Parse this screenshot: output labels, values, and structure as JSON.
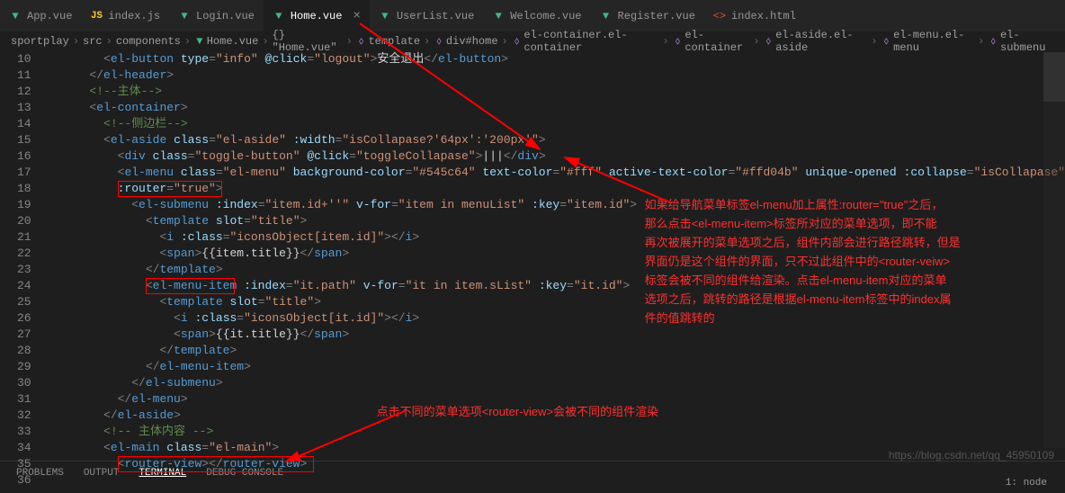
{
  "tabs": [
    {
      "icon": "vue",
      "label": "App.vue",
      "active": false
    },
    {
      "icon": "js",
      "label": "index.js",
      "active": false
    },
    {
      "icon": "vue",
      "label": "Login.vue",
      "active": false
    },
    {
      "icon": "vue",
      "label": "Home.vue",
      "active": true
    },
    {
      "icon": "vue",
      "label": "UserList.vue",
      "active": false
    },
    {
      "icon": "vue",
      "label": "Welcome.vue",
      "active": false
    },
    {
      "icon": "vue",
      "label": "Register.vue",
      "active": false
    },
    {
      "icon": "html",
      "label": "index.html",
      "active": false
    }
  ],
  "breadcrumbs": [
    "sportplay",
    "src",
    "components",
    "Home.vue",
    "{} \"Home.vue\"",
    "template",
    "div#home",
    "el-container.el-container",
    "el-container",
    "el-aside.el-aside",
    "el-menu.el-menu",
    "el-submenu"
  ],
  "firstLine": 10,
  "lastLine": 36,
  "code": {
    "l10": {
      "t1": "el-button",
      "a1": "type",
      "v1": "\"info\"",
      "a2": "@click",
      "v2": "\"logout\"",
      "text": "安全退出",
      "cl": "el-button"
    },
    "l11": {
      "cl": "el-header"
    },
    "l12": {
      "cm": "主体"
    },
    "l13": {
      "t": "el-container"
    },
    "l14": {
      "cm": "侧边栏"
    },
    "l15": {
      "t": "el-aside",
      "a1": "class",
      "v1": "\"el-aside\"",
      "a2": ":width",
      "v2": "\"isCollapase?'64px':'200px'\""
    },
    "l16": {
      "t": "div",
      "a1": "class",
      "v1": "\"toggle-button\"",
      "a2": "@click",
      "v2": "\"toggleCollapase\"",
      "text": "|||",
      "cl": "div"
    },
    "l17": {
      "t": "el-menu",
      "a1": "class",
      "v1": "\"el-menu\"",
      "a2": "background-color",
      "v2": "\"#545c64\"",
      "a3": "text-color",
      "v3": "\"#fff\"",
      "a4": "active-text-color",
      "v4": "\"#ffd04b\"",
      "a5": "unique-opened",
      "a6": ":collapse",
      "v6": "\"isCollapase\""
    },
    "l18": {
      "a": ":router",
      "v": "\"true\""
    },
    "l19": {
      "t": "el-submenu",
      "a1": ":index",
      "v1": "\"item.id+''\"",
      "a2": "v-for",
      "v2": "\"item in menuList\"",
      "a3": ":key",
      "v3": "\"item.id\""
    },
    "l20": {
      "t": "template",
      "a1": "slot",
      "v1": "\"title\""
    },
    "l21": {
      "t": "i",
      "a1": ":class",
      "v1": "\"iconsObject[item.id]\"",
      "cl": "i"
    },
    "l22": {
      "t": "span",
      "m": "{{item.title}}",
      "cl": "span"
    },
    "l23": {
      "cl": "template"
    },
    "l24": {
      "t": "el-menu-item",
      "a1": ":index",
      "v1": "\"it.path\"",
      "a2": "v-for",
      "v2": "\"it in item.sList\"",
      "a3": ":key",
      "v3": "\"it.id\""
    },
    "l25": {
      "t": "template",
      "a1": "slot",
      "v1": "\"title\""
    },
    "l26": {
      "t": "i",
      "a1": ":class",
      "v1": "\"iconsObject[it.id]\"",
      "cl": "i"
    },
    "l27": {
      "t": "span",
      "m": "{{it.title}}",
      "cl": "span"
    },
    "l28": {
      "cl": "template"
    },
    "l29": {
      "cl": "el-menu-item"
    },
    "l30": {
      "cl": "el-submenu"
    },
    "l31": {
      "cl": "el-menu"
    },
    "l32": {
      "cl": "el-aside"
    },
    "l33": {
      "cm": " 主体内容 "
    },
    "l34": {
      "t": "el-main",
      "a1": "class",
      "v1": "\"el-main\""
    },
    "l35": {
      "t": "router-view",
      "cl": "router-view"
    }
  },
  "annotation_right": [
    "如果给导航菜单标签el-menu加上属性:router=\"true\"之后，",
    "那么点击<el-menu-item>标签所对应的菜单选项，即不能",
    "再次被展开的菜单选项之后，组件内部会进行路径跳转，但是",
    "界面仍是这个组件的界面，只不过此组件中的<router-veiw>",
    "标签会被不同的组件给渲染。点击el-menu-item对应的菜单",
    "选项之后，跳转的路径是根据el-menu-item标签中的index属",
    "件的值跳转的"
  ],
  "annotation_bottom": "点击不同的菜单选项<router-view>会被不同的组件渲染",
  "panel_tabs": {
    "p": "PROBLEMS",
    "o": "OUTPUT",
    "t": "TERMINAL",
    "d": "DEBUG CONSOLE"
  },
  "status": "1: node",
  "watermark": "https://blog.csdn.net/qq_45950109"
}
